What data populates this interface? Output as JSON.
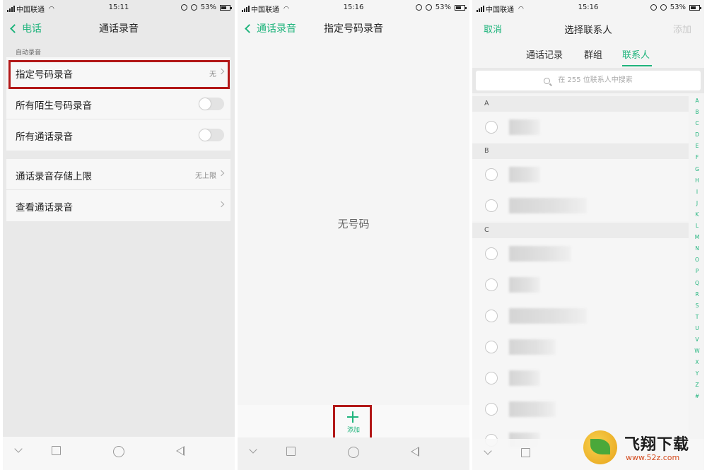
{
  "status": {
    "carrier": "中国联通",
    "battery": "53%",
    "time_1": "15:11",
    "time_2": "15:16",
    "time_3": "15:16"
  },
  "screen1": {
    "back_label": "电话",
    "title": "通话录音",
    "section_label": "自动录音",
    "rows_group1": [
      {
        "label": "指定号码录音",
        "value": "无"
      },
      {
        "label": "所有陌生号码录音"
      },
      {
        "label": "所有通话录音"
      }
    ],
    "rows_group2": [
      {
        "label": "通话录音存储上限",
        "value": "无上限"
      },
      {
        "label": "查看通话录音"
      }
    ]
  },
  "screen2": {
    "back_label": "通话录音",
    "title": "指定号码录音",
    "empty_text": "无号码",
    "add_label": "添加"
  },
  "screen3": {
    "cancel_label": "取消",
    "title": "选择联系人",
    "add_label": "添加",
    "tabs": [
      "通话记录",
      "群组",
      "联系人"
    ],
    "active_tab": "联系人",
    "search_placeholder": "在 255 位联系人中搜索",
    "groups": [
      "A",
      "B",
      "C"
    ],
    "index_letters": [
      "A",
      "B",
      "C",
      "D",
      "E",
      "F",
      "G",
      "H",
      "I",
      "J",
      "K",
      "L",
      "M",
      "N",
      "O",
      "P",
      "Q",
      "R",
      "S",
      "T",
      "U",
      "V",
      "W",
      "X",
      "Y",
      "Z",
      "#"
    ]
  },
  "watermark": {
    "brand": "飞翔下载",
    "url": "www.52z.com"
  },
  "colors": {
    "accent": "#1fb47c",
    "highlight": "#b21818"
  }
}
